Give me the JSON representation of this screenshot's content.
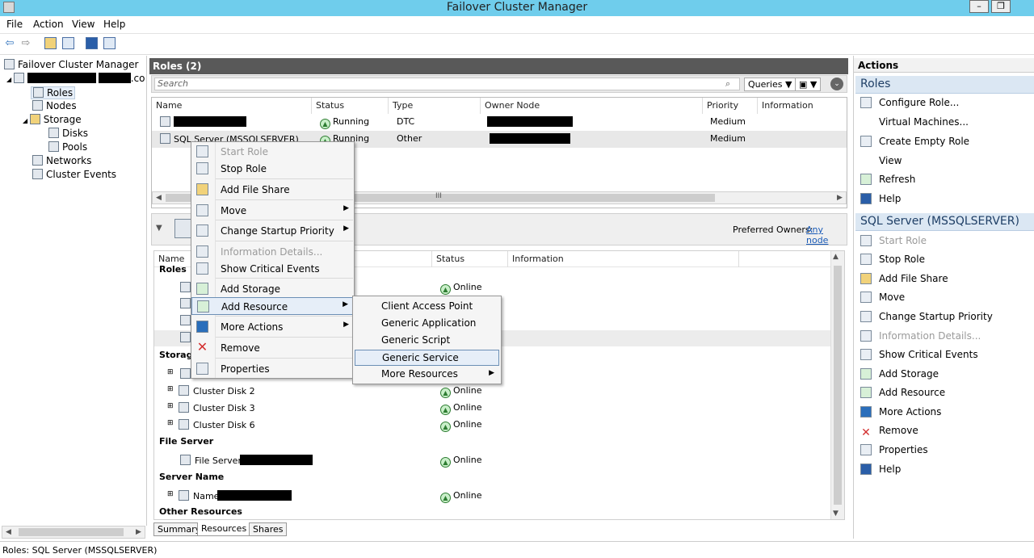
{
  "window": {
    "title": "Failover Cluster Manager",
    "minimize": "–",
    "restore": "❐",
    "close": "✕"
  },
  "menu": [
    "File",
    "Action",
    "View",
    "Help"
  ],
  "tree": {
    "root": "Failover Cluster Manager",
    "cluster_suffix": ".co",
    "items": [
      "Roles",
      "Nodes",
      "Storage",
      "Disks",
      "Pools",
      "Networks",
      "Cluster Events"
    ]
  },
  "roles_panel": {
    "header": "Roles (2)",
    "search_placeholder": "Search",
    "queries_label": "Queries",
    "columns": [
      "Name",
      "Status",
      "Type",
      "Owner Node",
      "Priority",
      "Information"
    ],
    "rows": [
      {
        "name": "",
        "status": "Running",
        "type": "DTC",
        "owner": "",
        "priority": "Medium"
      },
      {
        "name": "SQL Server (MSSQLSERVER)",
        "status": "Running",
        "type": "Other",
        "owner": "",
        "priority": "Medium"
      }
    ],
    "scroll_mid": "III"
  },
  "detail": {
    "preferred_owners_label": "Preferred Owners:",
    "preferred_owners_link": "Any node",
    "columns": [
      "Name",
      "Status",
      "Information"
    ],
    "groups": {
      "roles": "Roles",
      "storage": "Storage",
      "file_server": "File Server",
      "server_name": "Server Name",
      "other": "Other Resources"
    },
    "online": "Online",
    "disks": [
      "Cluster Disk 2",
      "Cluster Disk 3",
      "Cluster Disk 6"
    ],
    "file_server_item": "File Server (\\",
    "server_name_item": "Name:"
  },
  "tabs": [
    "Summary",
    "Resources",
    "Shares"
  ],
  "context_menu": {
    "items": [
      {
        "label": "Start Role",
        "disabled": true
      },
      {
        "label": "Stop Role"
      },
      {
        "label": "Add File Share"
      },
      {
        "label": "Move",
        "submenu": true
      },
      {
        "label": "Change Startup Priority",
        "submenu": true
      },
      {
        "label": "Information Details...",
        "disabled": true
      },
      {
        "label": "Show Critical Events"
      },
      {
        "label": "Add Storage"
      },
      {
        "label": "Add Resource",
        "submenu": true
      },
      {
        "label": "More Actions",
        "submenu": true
      },
      {
        "label": "Remove"
      },
      {
        "label": "Properties"
      }
    ]
  },
  "submenu": {
    "items": [
      "Client Access Point",
      "Generic Application",
      "Generic Script",
      "Generic Service",
      "More Resources"
    ],
    "highlighted": "Generic Service"
  },
  "actions": {
    "title": "Actions",
    "roles_section": "Roles",
    "roles_items": [
      "Configure Role...",
      "Virtual Machines...",
      "Create Empty Role",
      "View",
      "Refresh",
      "Help"
    ],
    "sql_section": "SQL Server (MSSQLSERVER)",
    "sql_items": [
      "Start Role",
      "Stop Role",
      "Add File Share",
      "Move",
      "Change Startup Priority",
      "Information Details...",
      "Show Critical Events",
      "Add Storage",
      "Add Resource",
      "More Actions",
      "Remove",
      "Properties",
      "Help"
    ]
  },
  "statusbar": "Roles:  SQL Server (MSSQLSERVER)",
  "colors": {
    "titlebar": "#6fcdec",
    "section": "#dbe7f3",
    "online": "#2e7d32",
    "remove": "#d32f2f"
  }
}
